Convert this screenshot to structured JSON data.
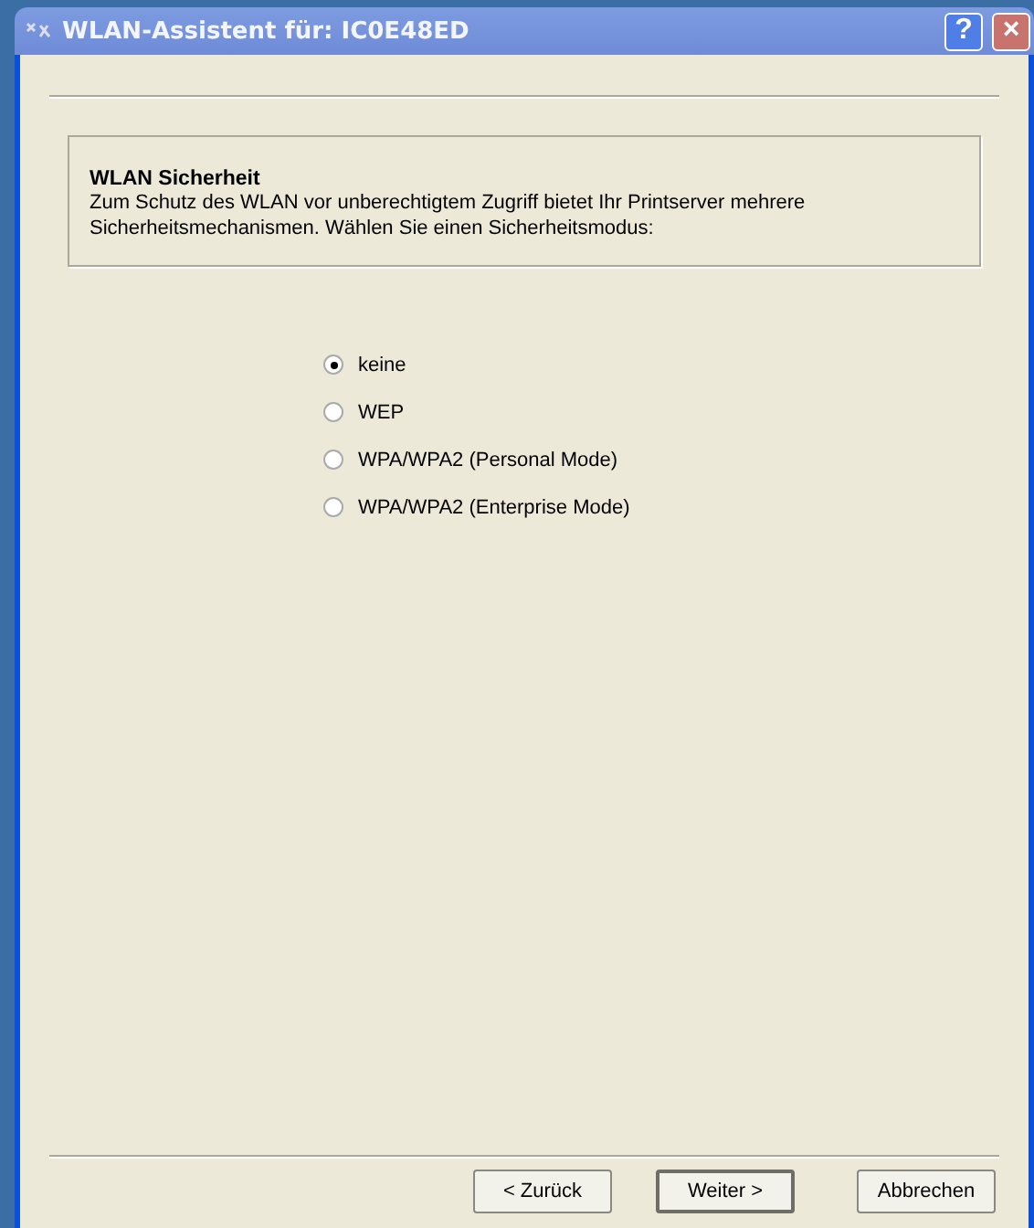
{
  "window": {
    "title": "WLAN-Assistent für: IC0E48ED",
    "help_button": "?",
    "close_button": "×"
  },
  "header": {
    "title": "WLAN Sicherheit",
    "description": "Zum Schutz des WLAN vor unberechtigtem Zugriff bietet Ihr Printserver mehrere Sicherheitsmechanismen. Wählen Sie einen Sicherheitsmodus:"
  },
  "options": [
    {
      "label": "keine",
      "selected": true
    },
    {
      "label": "WEP",
      "selected": false
    },
    {
      "label": "WPA/WPA2 (Personal Mode)",
      "selected": false
    },
    {
      "label": "WPA/WPA2 (Enterprise Mode)",
      "selected": false
    }
  ],
  "buttons": [
    {
      "label": "< Zurück",
      "default": false
    },
    {
      "label": "Weiter >",
      "default": true
    },
    {
      "label": "Abbrechen",
      "default": false
    }
  ]
}
